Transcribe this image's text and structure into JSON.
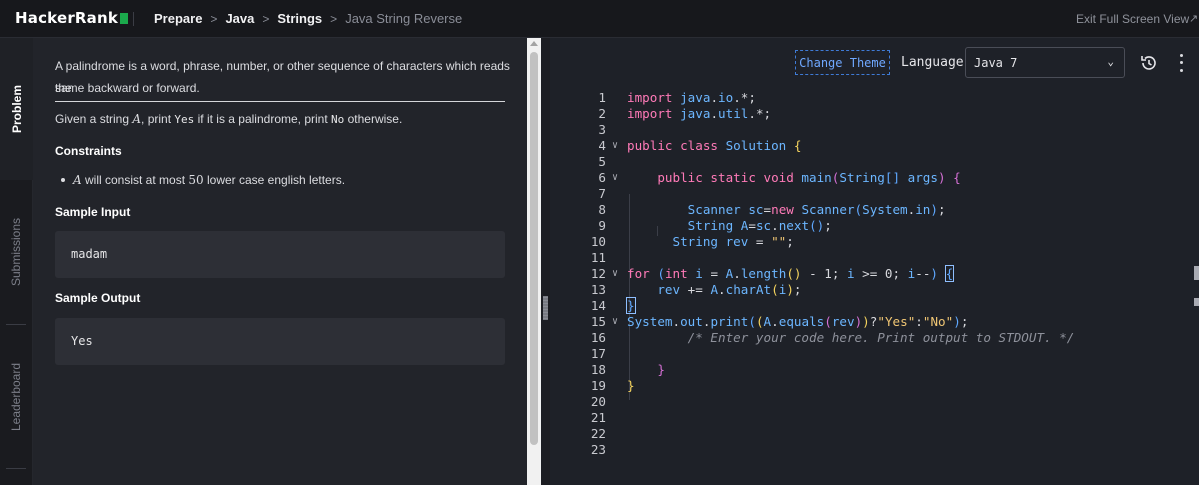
{
  "topbar": {
    "logo": "HackerRank",
    "breadcrumb": [
      "Prepare",
      "Java",
      "Strings"
    ],
    "current": "Java String Reverse",
    "exit_fullscreen": "Exit Full Screen View"
  },
  "sidebar": {
    "tabs": [
      {
        "label": "Problem",
        "active": true
      },
      {
        "label": "Submissions",
        "active": false
      },
      {
        "label": "Leaderboard",
        "active": false
      }
    ]
  },
  "problem": {
    "intro_line1": "A palindrome is a word, phrase, number, or other sequence of characters which reads the",
    "intro_line2": "same backward or forward.",
    "given_pre": "Given a string ",
    "given_var": "A",
    "given_mid": ", print ",
    "given_yes": "Yes",
    "given_mid2": " if it is a palindrome, print ",
    "given_no": "No",
    "given_post": " otherwise.",
    "constraints_title": "Constraints",
    "constraint_var": "A",
    "constraint_pre": " will consist at most ",
    "constraint_num": "50",
    "constraint_post": " lower case english letters.",
    "sample_input_title": "Sample Input",
    "sample_input": "madam",
    "sample_output_title": "Sample Output",
    "sample_output": "Yes"
  },
  "editor": {
    "change_theme": "Change Theme",
    "language_label": "Language",
    "language_value": "Java 7",
    "line_numbers": [
      "1",
      "2",
      "3",
      "4",
      "5",
      "6",
      "7",
      "8",
      "9",
      "10",
      "11",
      "12",
      "13",
      "14",
      "15",
      "16",
      "17",
      "18",
      "19",
      "20",
      "21",
      "22",
      "23"
    ]
  },
  "colors": {
    "accent_green": "#1ba94c",
    "theme_button": "#3f7bd6",
    "keyword": "#ff7ab8",
    "type": "#6cb6ff",
    "string": "#f0c674"
  }
}
